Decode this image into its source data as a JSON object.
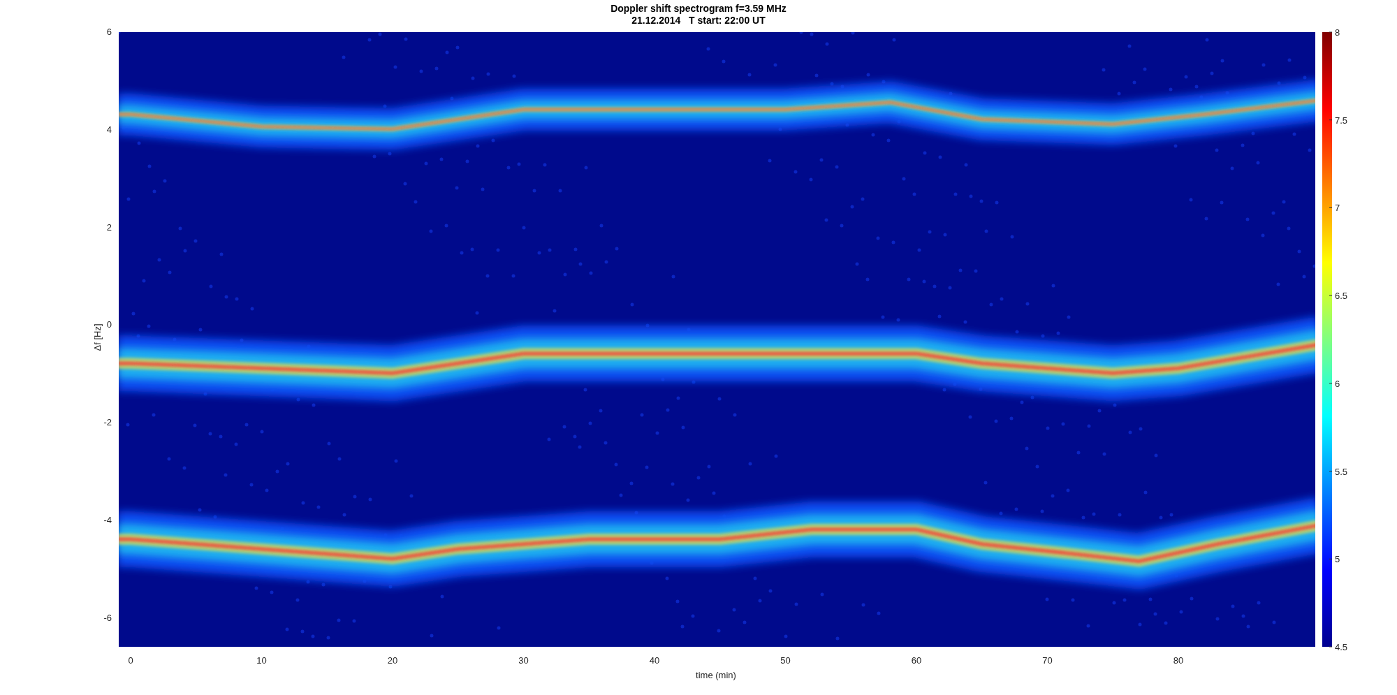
{
  "title": [
    "Doppler shift spectrogram f=3.59 MHz",
    "21.12.2014   T start: 22:00 UT"
  ],
  "axes": {
    "xlabel": "time (min)",
    "ylabel": "Δf [Hz]",
    "xticks": [
      "0",
      "10",
      "20",
      "30",
      "40",
      "50",
      "60",
      "70",
      "80"
    ],
    "yticks": [
      "6",
      "4",
      "2",
      "0",
      "-2",
      "-4",
      "-6"
    ]
  },
  "colorbar": {
    "ticks": [
      "8",
      "7.5",
      "7",
      "6.5",
      "6",
      "5.5",
      "5",
      "4.5"
    ]
  }
}
